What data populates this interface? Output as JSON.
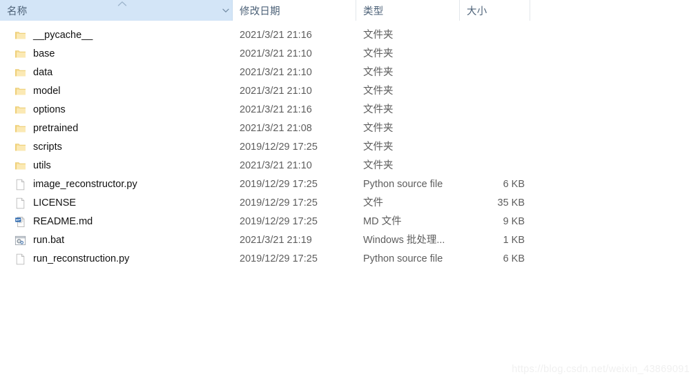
{
  "window": {
    "title": "File Explorer - Details View"
  },
  "columns": {
    "name": "名称",
    "date_modified": "修改日期",
    "type": "类型",
    "size": "大小",
    "sort_column": "名称",
    "sort_direction": "ascending",
    "dropdown_icon": "chevron-down-icon",
    "sort_icon": "chevron-up-icon"
  },
  "colors": {
    "header_active_bg": "#d3e5f7",
    "header_text": "#4d6278",
    "folder_icon": "#f4d47c",
    "row_text": "#111111",
    "secondary_text": "#5d5d5d",
    "watermark_text": "#f0f0f0",
    "md_badge": "#1f5fa9"
  },
  "files": [
    {
      "name": "__pycache__",
      "date": "2021/3/21 21:16",
      "type": "文件夹",
      "size": "",
      "icon": "folder-icon"
    },
    {
      "name": "base",
      "date": "2021/3/21 21:10",
      "type": "文件夹",
      "size": "",
      "icon": "folder-icon"
    },
    {
      "name": "data",
      "date": "2021/3/21 21:10",
      "type": "文件夹",
      "size": "",
      "icon": "folder-icon"
    },
    {
      "name": "model",
      "date": "2021/3/21 21:10",
      "type": "文件夹",
      "size": "",
      "icon": "folder-icon"
    },
    {
      "name": "options",
      "date": "2021/3/21 21:16",
      "type": "文件夹",
      "size": "",
      "icon": "folder-icon"
    },
    {
      "name": "pretrained",
      "date": "2021/3/21 21:08",
      "type": "文件夹",
      "size": "",
      "icon": "folder-icon"
    },
    {
      "name": "scripts",
      "date": "2019/12/29 17:25",
      "type": "文件夹",
      "size": "",
      "icon": "folder-icon"
    },
    {
      "name": "utils",
      "date": "2021/3/21 21:10",
      "type": "文件夹",
      "size": "",
      "icon": "folder-icon"
    },
    {
      "name": "image_reconstructor.py",
      "date": "2019/12/29 17:25",
      "type": "Python source file",
      "size": "6 KB",
      "icon": "blank-document-icon"
    },
    {
      "name": "LICENSE",
      "date": "2019/12/29 17:25",
      "type": "文件",
      "size": "35 KB",
      "icon": "blank-document-icon"
    },
    {
      "name": "README.md",
      "date": "2019/12/29 17:25",
      "type": "MD 文件",
      "size": "9 KB",
      "icon": "markdown-document-icon"
    },
    {
      "name": "run.bat",
      "date": "2021/3/21 21:19",
      "type": "Windows 批处理...",
      "size": "1 KB",
      "icon": "batch-script-icon"
    },
    {
      "name": "run_reconstruction.py",
      "date": "2019/12/29 17:25",
      "type": "Python source file",
      "size": "6 KB",
      "icon": "blank-document-icon"
    }
  ],
  "watermark": "https://blog.csdn.net/weixin_43869091"
}
